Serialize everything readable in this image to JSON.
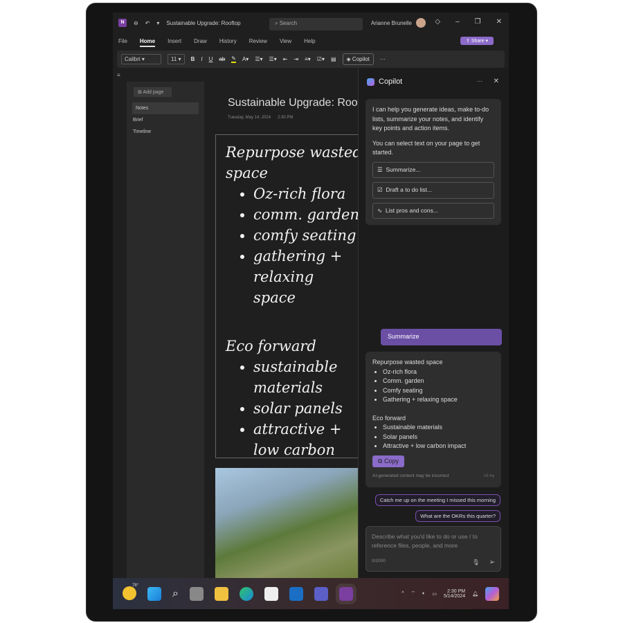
{
  "title": {
    "doc": "Sustainable Upgrade: Rooftop",
    "search": "Search",
    "user": "Arianne Brunelle"
  },
  "tabs": [
    "File",
    "Home",
    "Insert",
    "Draw",
    "History",
    "Review",
    "View",
    "Help"
  ],
  "share": "Share",
  "ribbon": {
    "font": "Calibri",
    "size": "11",
    "copilot": "Copilot"
  },
  "sidebar": {
    "add_page": "Add page",
    "pages": [
      "Notes",
      "Brief",
      "Timeline"
    ]
  },
  "page": {
    "title": "Sustainable Upgrade: Rooftop",
    "date": "Tuesday, May 14, 2024",
    "time": "2:30 PM",
    "ink": {
      "h1": "Repurpose wasted space",
      "items1": [
        "Oz-rich flora",
        "comm. garden",
        "comfy seating",
        "gathering + relaxing space"
      ],
      "h2": "Eco forward",
      "items2": [
        "sustainable materials",
        "solar panels",
        "attractive + low carbon impact"
      ]
    }
  },
  "copilot": {
    "title": "Copilot",
    "intro1": "I can help you generate ideas, make to-do lists, summarize your notes, and identify key points and action items.",
    "intro2": "You can select text on your page to get started.",
    "suggestions": [
      "Summarize...",
      "Draft a to do list...",
      "List pros and cons..."
    ],
    "user_msg": "Summarize",
    "response": {
      "h1": "Repurpose wasted space",
      "items1": [
        "Oz-rich flora",
        "Comm. garden",
        "Comfy seating",
        "Gathering + relaxing space"
      ],
      "h2": "Eco forward",
      "items2": [
        "Sustainable materials",
        "Solar panels",
        "Attractive + low carbon impact"
      ]
    },
    "copy": "Copy",
    "disclaimer": "AI-generated content may be incorrect",
    "chips": [
      "Catch me up on the meeting I missed this morning",
      "What are the OKRs this quarter?"
    ],
    "input_placeholder": "Describe what you'd like to do or use / to reference files, people, and more",
    "counter": "0/2000"
  },
  "taskbar": {
    "weather": "78°",
    "time": "2:30 PM",
    "date": "5/14/2024"
  }
}
